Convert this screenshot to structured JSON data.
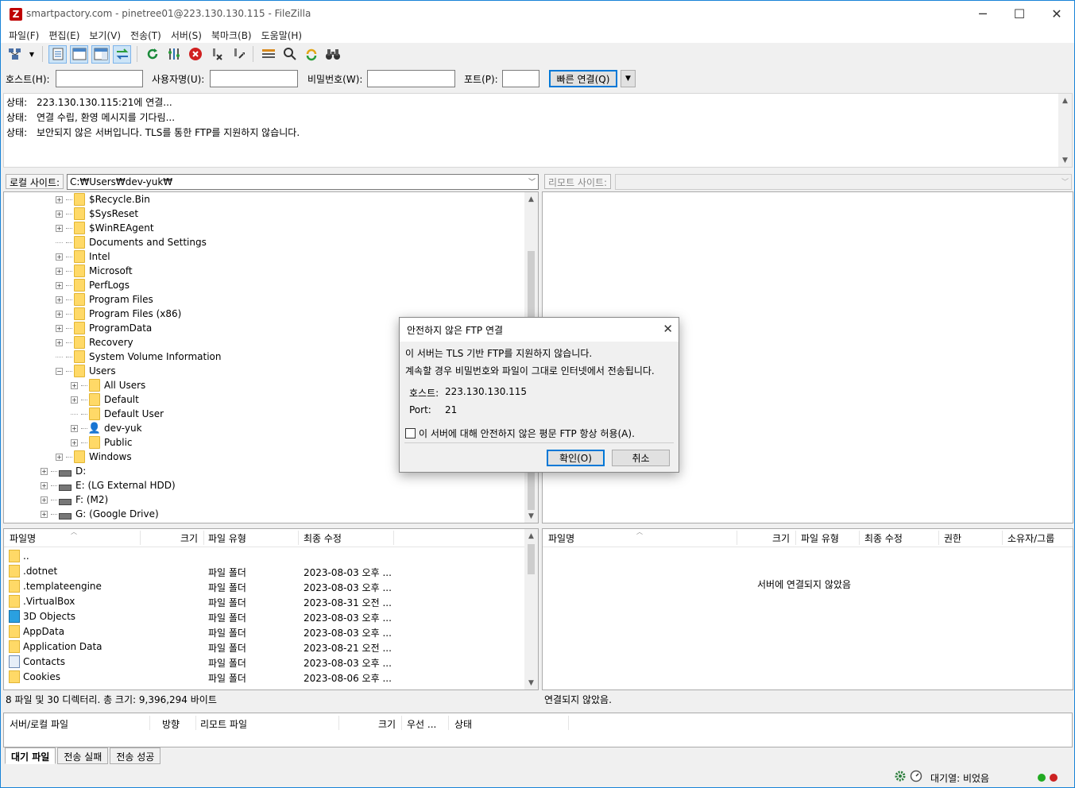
{
  "window": {
    "title": "smartpactory.com - pinetree01@223.130.130.115 - FileZilla",
    "app_icon": "Z",
    "minimize": "─",
    "maximize": "☐",
    "close": "✕"
  },
  "menu": [
    "파일(F)",
    "편집(E)",
    "보기(V)",
    "전송(T)",
    "서버(S)",
    "북마크(B)",
    "도움말(H)"
  ],
  "quickconnect": {
    "host_label": "호스트(H):",
    "user_label": "사용자명(U):",
    "pass_label": "비밀번호(W):",
    "port_label": "포트(P):",
    "host_value": "",
    "user_value": "",
    "pass_value": "",
    "port_value": "",
    "connect_button": "빠른 연결(Q)",
    "dropdown": "▼"
  },
  "log": [
    {
      "label": "상태:",
      "text": "223.130.130.115:21에 연결..."
    },
    {
      "label": "상태:",
      "text": "연결 수립, 환영 메시지를 기다림..."
    },
    {
      "label": "상태:",
      "text": "보안되지 않은 서버입니다. TLS를 통한 FTP를 지원하지 않습니다."
    }
  ],
  "local": {
    "site_label": "로컬 사이트:",
    "path": "C:₩Users₩dev-yuk₩",
    "tree": [
      {
        "name": "$Recycle.Bin",
        "expander": "+",
        "type": "folder"
      },
      {
        "name": "$SysReset",
        "expander": "+",
        "type": "folder"
      },
      {
        "name": "$WinREAgent",
        "expander": "+",
        "type": "folder"
      },
      {
        "name": "Documents and Settings",
        "expander": "",
        "type": "folder"
      },
      {
        "name": "Intel",
        "expander": "+",
        "type": "folder"
      },
      {
        "name": "Microsoft",
        "expander": "+",
        "type": "folder"
      },
      {
        "name": "PerfLogs",
        "expander": "+",
        "type": "folder"
      },
      {
        "name": "Program Files",
        "expander": "+",
        "type": "folder"
      },
      {
        "name": "Program Files (x86)",
        "expander": "+",
        "type": "folder"
      },
      {
        "name": "ProgramData",
        "expander": "+",
        "type": "folder"
      },
      {
        "name": "Recovery",
        "expander": "+",
        "type": "folder"
      },
      {
        "name": "System Volume Information",
        "expander": "",
        "type": "folder"
      },
      {
        "name": "Users",
        "expander": "−",
        "type": "folder"
      },
      {
        "name": "All Users",
        "expander": "+",
        "type": "folder"
      },
      {
        "name": "Default",
        "expander": "+",
        "type": "folder"
      },
      {
        "name": "Default User",
        "expander": "",
        "type": "folder"
      },
      {
        "name": "dev-yuk",
        "expander": "+",
        "type": "user"
      },
      {
        "name": "Public",
        "expander": "+",
        "type": "folder"
      },
      {
        "name": "Windows",
        "expander": "+",
        "type": "folder"
      },
      {
        "name": "D:",
        "expander": "+",
        "type": "drive"
      },
      {
        "name": "E: (LG External HDD)",
        "expander": "+",
        "type": "drive"
      },
      {
        "name": "F: (M2)",
        "expander": "+",
        "type": "drive"
      },
      {
        "name": "G: (Google Drive)",
        "expander": "+",
        "type": "drive"
      }
    ],
    "columns": [
      "파일명",
      "크기",
      "파일 유형",
      "최종 수정"
    ],
    "files": [
      {
        "name": "..",
        "type": "",
        "modified": "",
        "icon": "folder"
      },
      {
        "name": ".dotnet",
        "type": "파일 폴더",
        "modified": "2023-08-03 오후 ...",
        "icon": "folder"
      },
      {
        "name": ".templateengine",
        "type": "파일 폴더",
        "modified": "2023-08-03 오후 ...",
        "icon": "folder"
      },
      {
        "name": ".VirtualBox",
        "type": "파일 폴더",
        "modified": "2023-08-31 오전 ...",
        "icon": "folder"
      },
      {
        "name": "3D Objects",
        "type": "파일 폴더",
        "modified": "2023-08-03 오후 ...",
        "icon": "cube"
      },
      {
        "name": "AppData",
        "type": "파일 폴더",
        "modified": "2023-08-03 오후 ...",
        "icon": "folder"
      },
      {
        "name": "Application Data",
        "type": "파일 폴더",
        "modified": "2023-08-21 오전 ...",
        "icon": "folder"
      },
      {
        "name": "Contacts",
        "type": "파일 폴더",
        "modified": "2023-08-03 오후 ...",
        "icon": "contact"
      },
      {
        "name": "Cookies",
        "type": "파일 폴더",
        "modified": "2023-08-06 오후 ...",
        "icon": "folder"
      }
    ],
    "status": "8 파일 및 30 디렉터리. 총 크기: 9,396,294 바이트"
  },
  "remote": {
    "site_label": "리모트 사이트:",
    "path": "",
    "columns": [
      "파일명",
      "크기",
      "파일 유형",
      "최종 수정",
      "권한",
      "소유자/그룹"
    ],
    "empty_message": "서버에 연결되지 않았음",
    "status": "연결되지 않았음."
  },
  "queue": {
    "columns": [
      "서버/로컬 파일",
      "방향",
      "리모트 파일",
      "크기",
      "우선 ...",
      "상태"
    ],
    "tabs": [
      "대기 파일",
      "전송 실패",
      "전송 성공"
    ]
  },
  "statusbar": {
    "queue_text": "대기열: 비었음"
  },
  "dialog": {
    "title": "안전하지 않은 FTP 연결",
    "line1": "이 서버는 TLS 기반 FTP를 지원하지 않습니다.",
    "line2": "계속할 경우 비밀번호와 파일이 그대로 인터넷에서 전송됩니다.",
    "host_label": "호스트:",
    "host_value": "223.130.130.115",
    "port_label": "Port:",
    "port_value": "21",
    "checkbox_label": "이 서버에 대해 안전하지 않은 평문 FTP 항상 허용(A).",
    "checkbox_checked": false,
    "ok": "확인(O)",
    "cancel": "취소"
  },
  "colors": {
    "accent": "#0078d7",
    "folder": "#ffd967",
    "led_green": "#22aa22",
    "led_red": "#cc2222"
  }
}
